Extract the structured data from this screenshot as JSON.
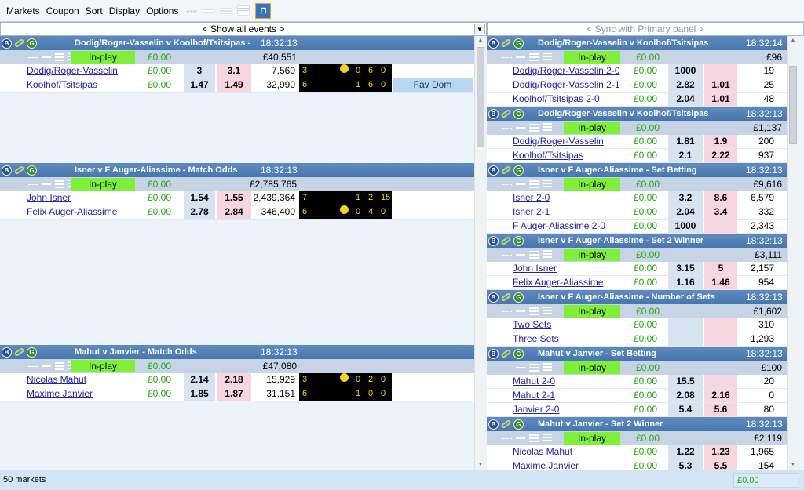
{
  "menu": [
    "Markets",
    "Coupon",
    "Sort",
    "Display",
    "Options"
  ],
  "left": {
    "header": "< Show all events >"
  },
  "right": {
    "header": "< Sync with Primary panel >"
  },
  "status": {
    "markets": "50 markets",
    "balance": "£0.00"
  },
  "inplay_label": "In-play",
  "left_markets": [
    {
      "title": "Dodig/Roger-Vasselin v Koolhof/Tsitsipas -",
      "time": "18:32:13",
      "zero": "£0.00",
      "matched": "£40,551",
      "runners": [
        {
          "name": "Dodig/Roger-Vasselin",
          "pl": "£0.00",
          "back": "3",
          "lay": "3.1",
          "vol": "7,560",
          "score": {
            "sets": "3",
            "serve": true,
            "a": "0",
            "b": "6",
            "c": "0"
          }
        },
        {
          "name": "Koolhof/Tsitsipas",
          "pl": "£0.00",
          "back": "1.47",
          "lay": "1.49",
          "vol": "32,990",
          "score": {
            "sets": "6",
            "serve": false,
            "a": "1",
            "b": "6",
            "c": "0"
          },
          "tag": "Fav Dom"
        }
      ]
    },
    {
      "title": "Isner v F Auger-Aliassime - Match Odds",
      "time": "18:32:13",
      "zero": "£0.00",
      "matched": "£2,785,765",
      "runners": [
        {
          "name": "John Isner",
          "pl": "£0.00",
          "back": "1.54",
          "lay": "1.55",
          "vol": "2,439,364",
          "score": {
            "sets": "7",
            "serve": false,
            "a": "1",
            "b": "2",
            "c": "15"
          }
        },
        {
          "name": "Felix Auger-Aliassime",
          "pl": "£0.00",
          "back": "2.78",
          "lay": "2.84",
          "vol": "346,400",
          "score": {
            "sets": "6",
            "serve": true,
            "a": "0",
            "b": "4",
            "c": "0"
          }
        }
      ]
    },
    {
      "title": "Mahut v Janvier - Match Odds",
      "time": "18:32:13",
      "zero": "£0.00",
      "matched": "£47,080",
      "runners": [
        {
          "name": "Nicolas Mahut",
          "pl": "£0.00",
          "back": "2.14",
          "lay": "2.18",
          "vol": "15,929",
          "score": {
            "sets": "3",
            "serve": true,
            "a": "0",
            "b": "2",
            "c": "0"
          }
        },
        {
          "name": "Maxime Janvier",
          "pl": "£0.00",
          "back": "1.85",
          "lay": "1.87",
          "vol": "31,151",
          "score": {
            "sets": "6",
            "serve": false,
            "a": "1",
            "b": "0",
            "c": "0"
          }
        }
      ]
    }
  ],
  "right_markets": [
    {
      "title": "Dodig/Roger-Vasselin v Koolhof/Tsitsipas",
      "time": "18:32:14",
      "zero": "£0.00",
      "matched": "£96",
      "runners": [
        {
          "name": "Dodig/Roger-Vasselin 2-0",
          "pl": "£0.00",
          "back": "1000",
          "lay": "",
          "vol": "19"
        },
        {
          "name": "Dodig/Roger-Vasselin 2-1",
          "pl": "£0.00",
          "back": "2.82",
          "lay": "1.01",
          "vol": "25"
        },
        {
          "name": "Koolhof/Tsitsipas 2-0",
          "pl": "£0.00",
          "back": "2.04",
          "lay": "1.01",
          "vol": "48"
        }
      ]
    },
    {
      "title": "Dodig/Roger-Vasselin v Koolhof/Tsitsipas",
      "time": "18:32:13",
      "zero": "£0.00",
      "matched": "£1,137",
      "runners": [
        {
          "name": "Dodig/Roger-Vasselin",
          "pl": "£0.00",
          "back": "1.81",
          "lay": "1.9",
          "vol": "200"
        },
        {
          "name": "Koolhof/Tsitsipas",
          "pl": "£0.00",
          "back": "2.1",
          "lay": "2.22",
          "vol": "937"
        }
      ]
    },
    {
      "title": "Isner v F Auger-Aliassime - Set Betting",
      "time": "18:32:13",
      "zero": "£0.00",
      "matched": "£9,616",
      "runners": [
        {
          "name": "Isner 2-0",
          "pl": "£0.00",
          "back": "3.2",
          "lay": "8.6",
          "vol": "6,579"
        },
        {
          "name": "Isner 2-1",
          "pl": "£0.00",
          "back": "2.04",
          "lay": "3.4",
          "vol": "332"
        },
        {
          "name": "F Auger-Aliassime 2-0",
          "pl": "£0.00",
          "back": "1000",
          "lay": "",
          "vol": "2,343"
        }
      ]
    },
    {
      "title": "Isner v F Auger-Aliassime - Set 2 Winner",
      "time": "18:32:13",
      "zero": "£0.00",
      "matched": "£3,111",
      "runners": [
        {
          "name": "John Isner",
          "pl": "£0.00",
          "back": "3.15",
          "lay": "5",
          "vol": "2,157"
        },
        {
          "name": "Felix Auger-Aliassime",
          "pl": "£0.00",
          "back": "1.16",
          "lay": "1.46",
          "vol": "954"
        }
      ]
    },
    {
      "title": "Isner v F Auger-Aliassime - Number of Sets",
      "time": "18:32:13",
      "zero": "£0.00",
      "matched": "£1,602",
      "runners": [
        {
          "name": "Two Sets",
          "pl": "£0.00",
          "back": "",
          "lay": "",
          "vol": "310"
        },
        {
          "name": "Three Sets",
          "pl": "£0.00",
          "back": "",
          "lay": "",
          "vol": "1,293"
        }
      ]
    },
    {
      "title": "Mahut v Janvier - Set Betting",
      "time": "18:32:13",
      "zero": "£0.00",
      "matched": "£100",
      "runners": [
        {
          "name": "Mahut 2-0",
          "pl": "£0.00",
          "back": "15.5",
          "lay": "",
          "vol": "20"
        },
        {
          "name": "Mahut 2-1",
          "pl": "£0.00",
          "back": "2.08",
          "lay": "2.16",
          "vol": "0"
        },
        {
          "name": "Janvier 2-0",
          "pl": "£0.00",
          "back": "5.4",
          "lay": "5.6",
          "vol": "80"
        }
      ]
    },
    {
      "title": "Mahut v Janvier - Set 2 Winner",
      "time": "18:32:13",
      "zero": "£0.00",
      "matched": "£2,119",
      "runners": [
        {
          "name": "Nicolas Mahut",
          "pl": "£0.00",
          "back": "1.22",
          "lay": "1.23",
          "vol": "1,965"
        },
        {
          "name": "Maxime Janvier",
          "pl": "£0.00",
          "back": "5.3",
          "lay": "5.5",
          "vol": "154"
        }
      ]
    }
  ]
}
